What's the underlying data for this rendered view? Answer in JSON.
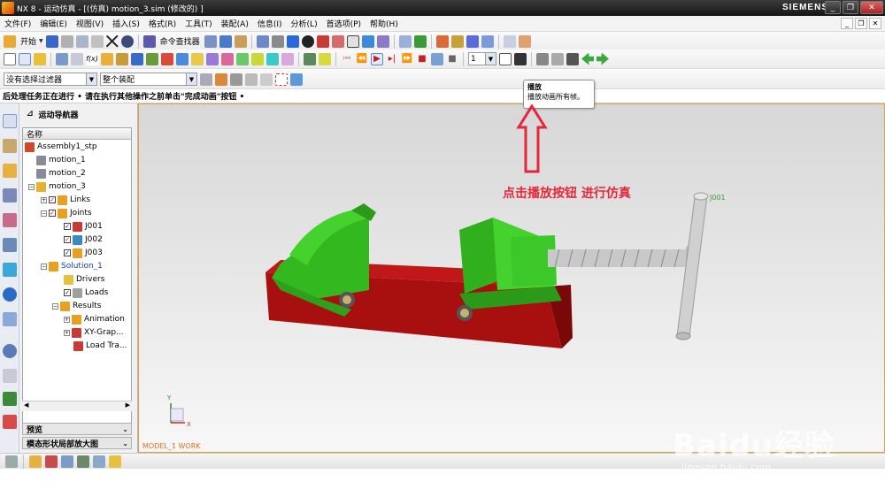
{
  "window": {
    "title": "NX 8 - 运动仿真 - [(仿真) motion_3.sim  (修改的) ]",
    "brand": "SIEMENS",
    "controls": [
      "_",
      "❐",
      "✕"
    ]
  },
  "menu": {
    "items": [
      "文件(F)",
      "编辑(E)",
      "视图(V)",
      "插入(S)",
      "格式(R)",
      "工具(T)",
      "装配(A)",
      "信息(I)",
      "分析(L)",
      "首选项(P)",
      "帮助(H)"
    ],
    "controls": [
      "_",
      "❐",
      "✕"
    ]
  },
  "toolbar": {
    "start_label": "开始",
    "command_finder_label": "命令查找器",
    "filter_value": "没有选择过滤器",
    "assembly_value": "整个装配",
    "frame_value": "1"
  },
  "status": {
    "prompt": "后处理任务正在进行 • 请在执行其他操作之前单击\"完成动画\"按钮 •"
  },
  "navigator": {
    "title": "运动导航器",
    "column_header": "名称",
    "tree": [
      {
        "label": "Assembly1_stp"
      },
      {
        "label": "motion_1"
      },
      {
        "label": "motion_2"
      },
      {
        "label": "motion_3"
      },
      {
        "label": "Links"
      },
      {
        "label": "Joints"
      },
      {
        "label": "J001"
      },
      {
        "label": "J002"
      },
      {
        "label": "J003"
      },
      {
        "label": "Solution_1"
      },
      {
        "label": "Drivers"
      },
      {
        "label": "Loads"
      },
      {
        "label": "Results"
      },
      {
        "label": "Animation"
      },
      {
        "label": "XY-Grap..."
      },
      {
        "label": "Load Tra..."
      }
    ],
    "panels": [
      "预览",
      "模态形状局部放大图"
    ]
  },
  "viewport": {
    "label": "MODEL_1 WORK",
    "joint_label": "J001",
    "axis_y": "Y",
    "axis_x": "X"
  },
  "tooltip": {
    "title": "播放",
    "body": "播放动画所有帧。"
  },
  "annotation": {
    "text": "点击播放按钮 进行仿真",
    "color": "#e4283a"
  },
  "watermark": {
    "main": "Baidu经验",
    "sub": "jingyan.baidu.com"
  },
  "colors": {
    "model_green": "#3cc828",
    "base_red": "#a81010",
    "viewport_border": "#e6a03c"
  }
}
